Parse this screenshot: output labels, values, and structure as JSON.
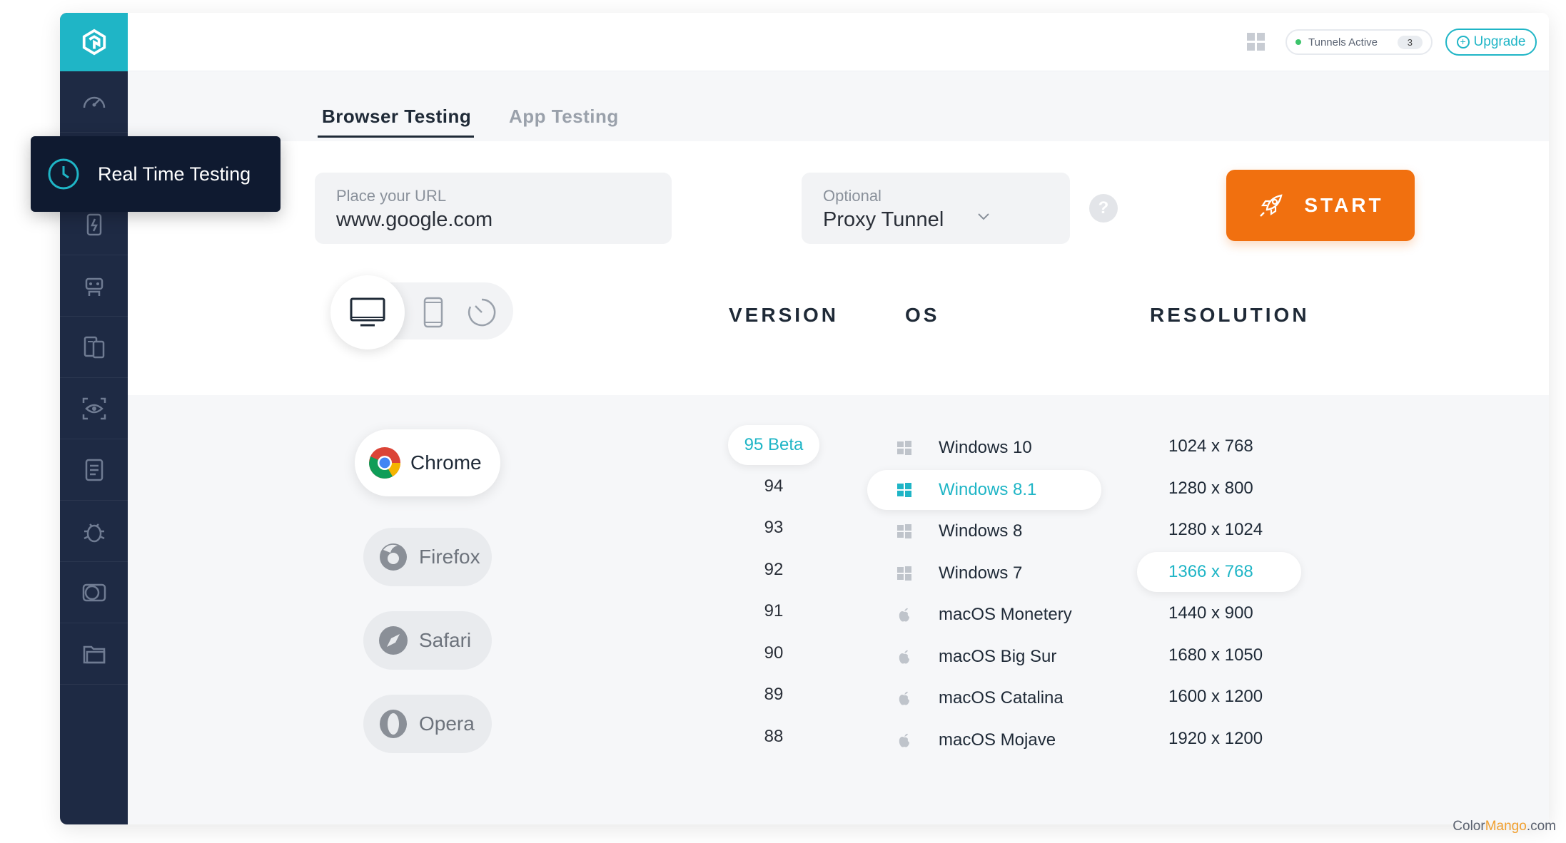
{
  "header": {
    "tunnels_label": "Tunnels Active",
    "tunnels_count": "3",
    "upgrade_label": "Upgrade"
  },
  "sidebar": {
    "tooltip": "Real Time Testing",
    "items": [
      "dashboard-icon",
      "realtime-icon",
      "automation-icon",
      "robot-icon",
      "devices-icon",
      "visual-icon",
      "document-icon",
      "bug-icon",
      "compare-icon",
      "folder-icon"
    ]
  },
  "tabs": {
    "active": "Browser Testing",
    "inactive": "App Testing"
  },
  "form": {
    "url_placeholder": "Place your URL",
    "url_value": "www.google.com",
    "tunnel_placeholder": "Optional",
    "tunnel_value": "Proxy Tunnel",
    "help": "?",
    "start_label": "START"
  },
  "columns": {
    "version": "VERSION",
    "os": "OS",
    "resolution": "RESOLUTION"
  },
  "browsers": [
    {
      "name": "Chrome",
      "selected": true
    },
    {
      "name": "Firefox",
      "selected": false
    },
    {
      "name": "Safari",
      "selected": false
    },
    {
      "name": "Opera",
      "selected": false
    }
  ],
  "versions": [
    "95 Beta",
    "94",
    "93",
    "92",
    "91",
    "90",
    "89",
    "88"
  ],
  "selected_version": "95 Beta",
  "os_list": [
    {
      "name": "Windows 10",
      "icon": "windows-icon"
    },
    {
      "name": "Windows 8.1",
      "icon": "windows-icon"
    },
    {
      "name": "Windows 8",
      "icon": "windows-icon"
    },
    {
      "name": "Windows 7",
      "icon": "windows-icon"
    },
    {
      "name": "macOS Monetery",
      "icon": "apple-icon"
    },
    {
      "name": "macOS Big Sur",
      "icon": "apple-icon"
    },
    {
      "name": "macOS Catalina",
      "icon": "apple-icon"
    },
    {
      "name": "macOS Mojave",
      "icon": "apple-icon"
    }
  ],
  "selected_os": "Windows 8.1",
  "resolutions": [
    "1024 x 768",
    "1280 x 800",
    "1280 x 1024",
    "1366 x 768",
    "1440 x 900",
    "1680 x 1050",
    "1600 x 1200",
    "1920 x 1200"
  ],
  "selected_resolution": "1366 x 768",
  "watermark": {
    "part1": "Color",
    "part2": "Mango",
    "part3": ".com"
  },
  "colors": {
    "accent": "#1fb5c6",
    "start": "#f1700f",
    "sidebar": "#1e2a44",
    "tooltip": "#0f1a30"
  }
}
